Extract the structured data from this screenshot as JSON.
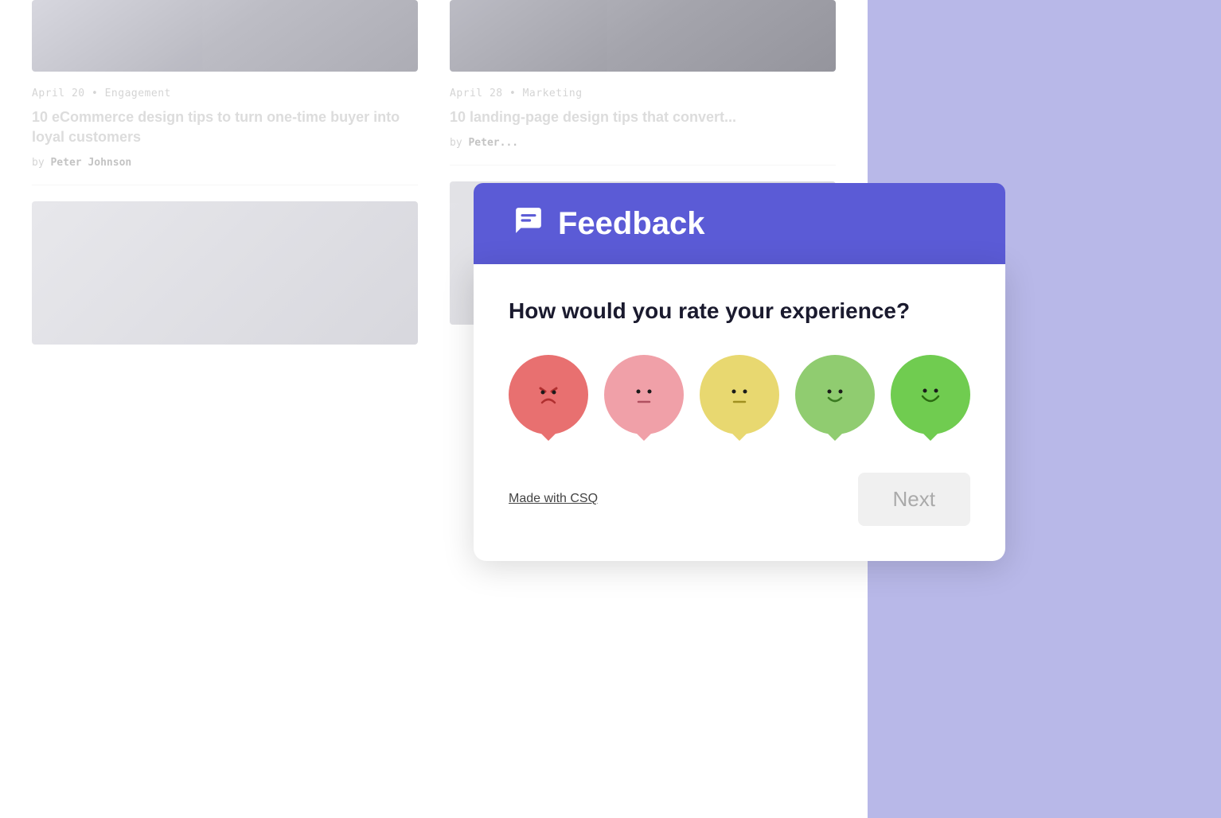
{
  "background": {
    "blog_bg": "#ffffff",
    "right_bg": "#b8b8e8"
  },
  "blog_cards": [
    {
      "meta": "April 20  •  Engagement",
      "title": "10 eCommerce design tips to turn one-time buyer into loyal customers",
      "author": "Peter Johnson"
    },
    {
      "meta": "April 28  •  Marketing",
      "title": "10 landing-page design tips that convert...",
      "author": "Peter..."
    }
  ],
  "feedback_widget": {
    "header_bg": "#5b5bd6",
    "icon": "💬",
    "title": "Feedback",
    "question": "How would you rate your experience?",
    "emojis": [
      {
        "label": "very-bad",
        "face": "😣",
        "bg": "#e87070",
        "aria": "Very bad"
      },
      {
        "label": "bad",
        "face": "😐",
        "bg": "#f0a0a8",
        "aria": "Bad"
      },
      {
        "label": "neutral",
        "face": "😑",
        "bg": "#e8d870",
        "aria": "Neutral"
      },
      {
        "label": "good",
        "face": "😊",
        "bg": "#90cc70",
        "aria": "Good"
      },
      {
        "label": "very-good",
        "face": "😁",
        "bg": "#70cc50",
        "aria": "Very good"
      }
    ],
    "footer_link": "Made with CSQ",
    "next_button": "Next"
  }
}
